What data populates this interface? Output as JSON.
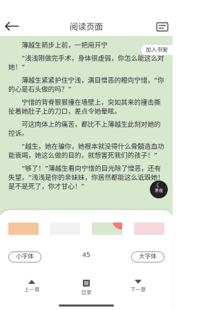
{
  "header": {
    "title": "阅读页面"
  },
  "reader": {
    "add_shelf": "加入书架",
    "paragraphs": [
      "薄越生箭步上前，一把用开宁",
      "“浅浅刚做完手术，身体很虚弱，你怎么能这么对她！”",
      "薄越生紧紧护住宁浅，满目憎恶的瞪向宁惜，“你的心是石头做的吗？”",
      "宁惜的背脊狠狠撞在墙壁上，突如其来的撞击撕扯着她肚子上的刀口，差点令她晕眩。",
      "可这肉体上的痛苦，都比不上薄越生此刻对她的控诉。",
      "“越生，她在骗你，她根本就没得什么骨髓造血功能衰竭，她这么做的目的，就想害死我们的孩子！”",
      "“够了！”薄越生看向宁惜的目光除了憎恶，还有失望，“浅浅是你的亲妹妹，你居然都能这么诋毁她！是不是死了，你才甘心！”"
    ]
  },
  "night_mode": {
    "label": "黑夜"
  },
  "settings": {
    "themes": [
      "#f6c699",
      "#f2f2f2",
      "#d7e8cf",
      "#f6d7dd"
    ],
    "font_smaller": "小字体",
    "font_size": "45",
    "font_larger": "大字体"
  },
  "nav": {
    "prev": "上一章",
    "catalog": "目录",
    "next": "下一章"
  }
}
